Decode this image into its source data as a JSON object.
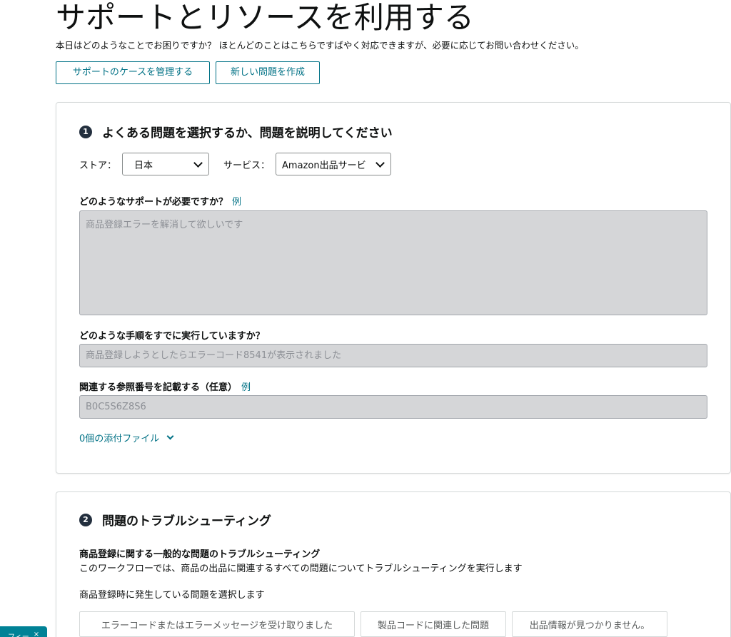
{
  "header": {
    "title": "サポートとリソースを利用する",
    "subtitle": "本日はどのようなことでお困りですか？ ほとんどのことはこちらですばやく対応できますが、必要に応じてお問い合わせください。",
    "manage_cases_label": "サポートのケースを管理する",
    "new_issue_label": "新しい問題を作成"
  },
  "step1": {
    "number": "1",
    "title": "よくある問題を選択するか、問題を説明してください",
    "store_label": "ストア：",
    "store_value": "日本",
    "service_label": "サービス：",
    "service_value": "Amazon出品サービ",
    "question1_label": "どのようなサポートが必要ですか？",
    "example_link": "例",
    "question1_placeholder": "商品登録エラーを解消して欲しいです",
    "question2_label": "どのような手順をすでに実行していますか？",
    "question2_placeholder": "商品登録しようとしたらエラーコード8541が表示されました",
    "question3_label": "関連する参照番号を記載する（任意）",
    "question3_placeholder": "B0C5S6Z8S6",
    "attachments_label": "0個の添付ファイル"
  },
  "step2": {
    "number": "2",
    "title": "問題のトラブルシューティング",
    "section_title": "商品登録に関する一般的な問題のトラブルシューティング",
    "section_desc": "このワークフローでは、商品の出品に関連するすべての問題についてトラブルシューティングを実行します",
    "prompt": "商品登録時に発生している問題を選択します",
    "choices": [
      "エラーコードまたはエラーメッセージを受け取りました",
      "製品コードに関連した問題",
      "出品情報が見つかりません。"
    ]
  },
  "feedback": {
    "label": "フィー",
    "close": "×"
  },
  "colors": {
    "accent": "#007185",
    "step_badge": "#232f3e",
    "input_fill": "#d5d6d8",
    "feedback_tab": "#008296"
  }
}
